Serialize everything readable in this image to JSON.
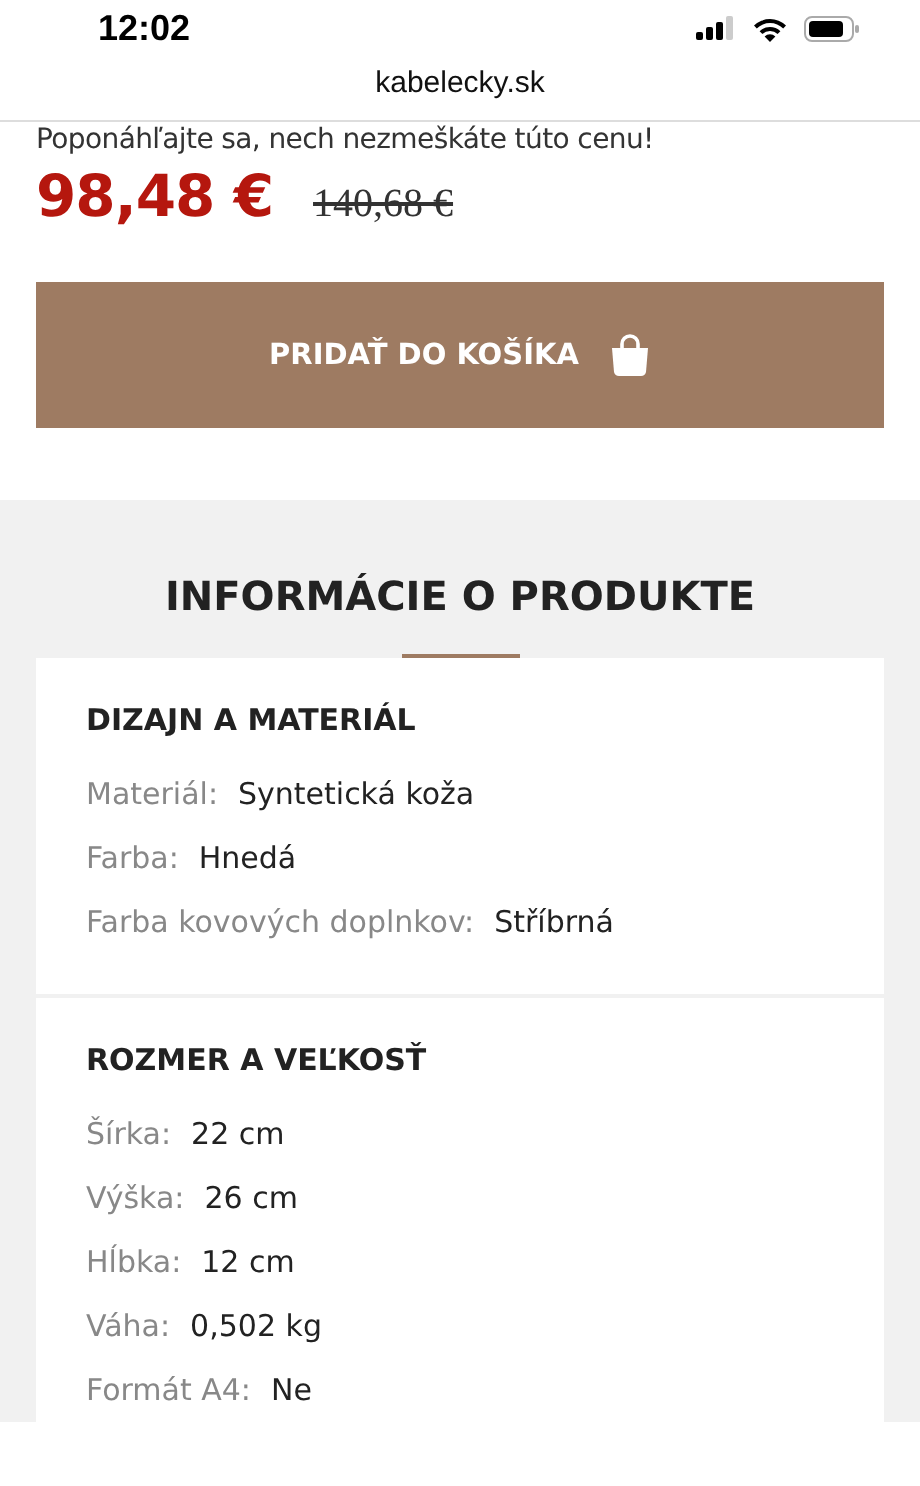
{
  "status_bar": {
    "time": "12:02"
  },
  "address_bar": {
    "url": "kabelecky.sk"
  },
  "promo_text": "Poponáhľajte sa, nech nezmeškáte túto cenu!",
  "price": {
    "current": "98,48 €",
    "original": "140,68 €"
  },
  "add_to_cart_button": {
    "label": "PRIDAŤ DO KOŠÍKA"
  },
  "product_info": {
    "title": "INFORMÁCIE O PRODUKTE",
    "sections": [
      {
        "title": "DIZAJN A MATERIÁL",
        "rows": [
          {
            "label": "Materiál:",
            "value": "Syntetická koža"
          },
          {
            "label": "Farba:",
            "value": "Hnedá"
          },
          {
            "label": "Farba kovových doplnkov:",
            "value": "Stříbrná"
          }
        ]
      },
      {
        "title": "ROZMER A VEĽKOSŤ",
        "rows": [
          {
            "label": "Šírka:",
            "value": "22 cm"
          },
          {
            "label": "Výška:",
            "value": "26 cm"
          },
          {
            "label": "Hĺbka:",
            "value": "12 cm"
          },
          {
            "label": "Váha:",
            "value": "0,502 kg"
          },
          {
            "label": "Formát A4:",
            "value": "Ne"
          }
        ]
      }
    ]
  }
}
